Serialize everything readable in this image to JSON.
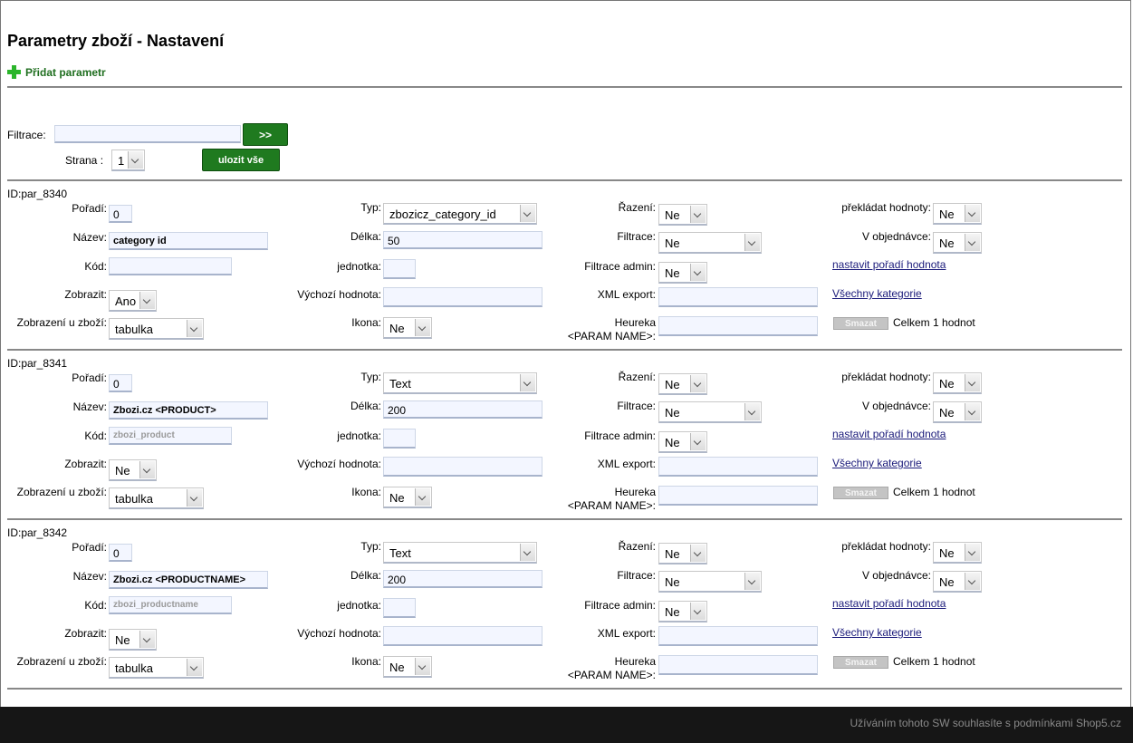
{
  "page_title": "Parametry zboží - Nastavení",
  "add_param_label": "Přidat parametr",
  "filter": {
    "label": "Filtrace:",
    "value": "",
    "go_label": ">>"
  },
  "page": {
    "label": "Strana :",
    "value": "1"
  },
  "save_all_label": "ulozit vše",
  "labels": {
    "poradi": "Pořadí:",
    "nazev": "Název:",
    "kod": "Kód:",
    "zobrazit": "Zobrazit:",
    "zobrazeni_u_zbozi": "Zobrazení u zboží:",
    "typ": "Typ:",
    "delka": "Délka:",
    "jednotka": "jednotka:",
    "vychozi": "Výchozí hodnota:",
    "ikona": "Ikona:",
    "razeni": "Řazení:",
    "filtrace": "Filtrace:",
    "filtrace_admin": "Filtrace admin:",
    "xml_export": "XML export:",
    "heureka_1": "Heureka",
    "heureka_2": "<PARAM  NAME>:",
    "prekladat": "překládat hodnoty:",
    "v_objednavce": "V objednávce:"
  },
  "links": {
    "set_order": "nastavit pořadí hodnota",
    "all_categories": "Všechny kategorie"
  },
  "delete_label": "Smazat",
  "params": [
    {
      "id": "ID:par_8340",
      "poradi": "0",
      "nazev": "category id",
      "kod": "",
      "zobrazit": "Ano",
      "zobrazeni": "tabulka",
      "typ": "zbozicz_category_id",
      "delka": "50",
      "jednotka": "",
      "vychozi": "",
      "ikona": "Ne",
      "razeni": "Ne",
      "filtrace": "Ne",
      "filtrace_admin": "Ne",
      "xml_export": "",
      "heureka": "",
      "prekladat": "Ne",
      "v_objednavce": "Ne",
      "total": "Celkem 1 hodnot"
    },
    {
      "id": "ID:par_8341",
      "poradi": "0",
      "nazev": "Zbozi.cz <PRODUCT>",
      "kod": "zbozi_product",
      "zobrazit": "Ne",
      "zobrazeni": "tabulka",
      "typ": "Text",
      "delka": "200",
      "jednotka": "",
      "vychozi": "",
      "ikona": "Ne",
      "razeni": "Ne",
      "filtrace": "Ne",
      "filtrace_admin": "Ne",
      "xml_export": "",
      "heureka": "",
      "prekladat": "Ne",
      "v_objednavce": "Ne",
      "total": "Celkem 1 hodnot"
    },
    {
      "id": "ID:par_8342",
      "poradi": "0",
      "nazev": "Zbozi.cz <PRODUCTNAME>",
      "kod": "zbozi_productname",
      "zobrazit": "Ne",
      "zobrazeni": "tabulka",
      "typ": "Text",
      "delka": "200",
      "jednotka": "",
      "vychozi": "",
      "ikona": "Ne",
      "razeni": "Ne",
      "filtrace": "Ne",
      "filtrace_admin": "Ne",
      "xml_export": "",
      "heureka": "",
      "prekladat": "Ne",
      "v_objednavce": "Ne",
      "total": "Celkem 1 hodnot"
    }
  ],
  "footer_text": "Užíváním tohoto SW souhlasíte s podmínkami Shop5.cz"
}
